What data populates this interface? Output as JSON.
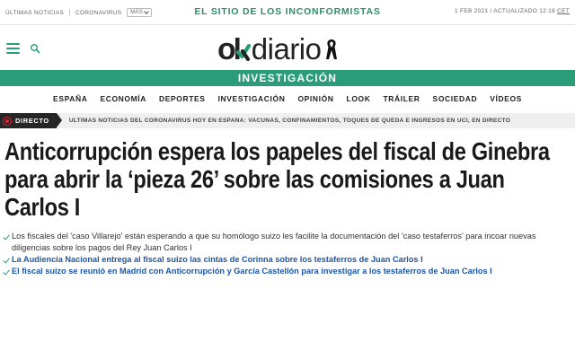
{
  "topbar": {
    "links": [
      "ÚLTIMAS NOTICIAS",
      "CORONAVIRUS"
    ],
    "more_label": "MÁS",
    "tagline": "EL SITIO DE LOS INCONFORMISTAS",
    "date": "1 FEB 2021 / ACTUALIZADO 12:18",
    "timezone": "CET"
  },
  "header": {
    "logo_ok": "ok",
    "logo_diario": "diario",
    "section": "INVESTIGACIÓN"
  },
  "nav": [
    "ESPAÑA",
    "ECONOMÍA",
    "DEPORTES",
    "INVESTIGACIÓN",
    "OPINIÓN",
    "LOOK",
    "TRÁILER",
    "SOCIEDAD",
    "VÍDEOS"
  ],
  "directo": {
    "label": "DIRECTO",
    "text": "ÚLTIMAS NOTICIAS DEL CORONAVIRUS HOY EN ESPAÑA: VACUNAS, CONFINAMIENTOS, TOQUES DE QUEDA E INGRESOS EN UCI, EN DIRECTO"
  },
  "article": {
    "headline": "Anticorrupción espera los papeles del fiscal de Ginebra para abrir la ‘pieza 26’ sobre las comisiones a Juan Carlos I",
    "summary": "Los fiscales del 'caso Villarejo' están esperando a que su homólogo suizo les facilite la documentación del 'caso testaferros' para incoar nuevas diligencias sobre los pagos del Rey Juan Carlos I",
    "related": [
      "La Audiencia Nacional entrega al fiscal suizo las cintas de Corinna sobre los testaferros de Juan Carlos I",
      "El fiscal suizo se reunió en Madrid con Anticorrupción y García Castellón para investigar a los testaferros de Juan Carlos I"
    ]
  },
  "colors": {
    "brand_green": "#2a9d78",
    "link_blue": "#1e56a5",
    "live_red": "#e22233"
  },
  "icons": [
    "menu-icon",
    "search-icon",
    "mourning-ribbon-icon",
    "live-icon",
    "check-icon"
  ]
}
